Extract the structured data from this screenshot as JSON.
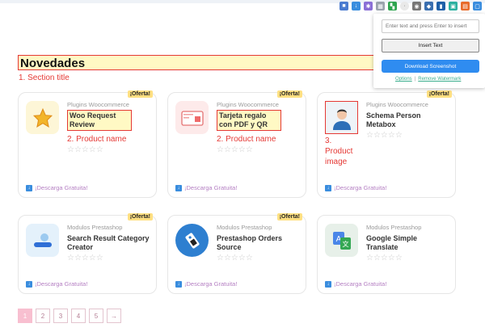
{
  "section": {
    "title": "Novedades",
    "annotation": "1. Section title"
  },
  "cards": [
    {
      "category": "Plugins Woocommerce",
      "name": "Woo Request Review",
      "badge": "¡Oferta!",
      "annotation": "2. Product name",
      "download": "¡Descarga Gratuita!"
    },
    {
      "category": "Plugins Woocommerce",
      "name": "Tarjeta regalo con PDF y QR",
      "badge": "¡Oferta!",
      "annotation": "2. Product name",
      "download": "¡Descarga Gratuita!"
    },
    {
      "category": "Plugins Woocommerce",
      "name": "Schema Person Metabox",
      "badge": "¡Oferta!",
      "annotation": "3. Product image",
      "download": "¡Descarga Gratuita!"
    },
    {
      "category": "Modulos Prestashop",
      "name": "Search Result Category Creator",
      "badge": "¡Oferta!",
      "download": "¡Descarga Gratuita!"
    },
    {
      "category": "Modulos Prestashop",
      "name": "Prestashop Orders Source",
      "badge": "¡Oferta!",
      "download": "¡Descarga Gratuita!"
    },
    {
      "category": "Modulos Prestashop",
      "name": "Google Simple Translate",
      "download": "¡Descarga Gratuita!"
    }
  ],
  "pagination": {
    "pages": [
      "1",
      "2",
      "3",
      "4",
      "5"
    ],
    "next": "→",
    "current": "1"
  },
  "popup": {
    "input_placeholder": "Enter text and press Enter to insert",
    "insert_label": "Insert Text",
    "download_label": "Download Screenshot",
    "options_label": "Options",
    "separator": "|",
    "remove_label": "Remove Watermark"
  },
  "colors": {
    "annotation": "#e53935",
    "highlight": "#fff9c4",
    "download_link": "#b580c3",
    "download_button": "#2f8cf0",
    "page_active": "#f8bfd0"
  }
}
